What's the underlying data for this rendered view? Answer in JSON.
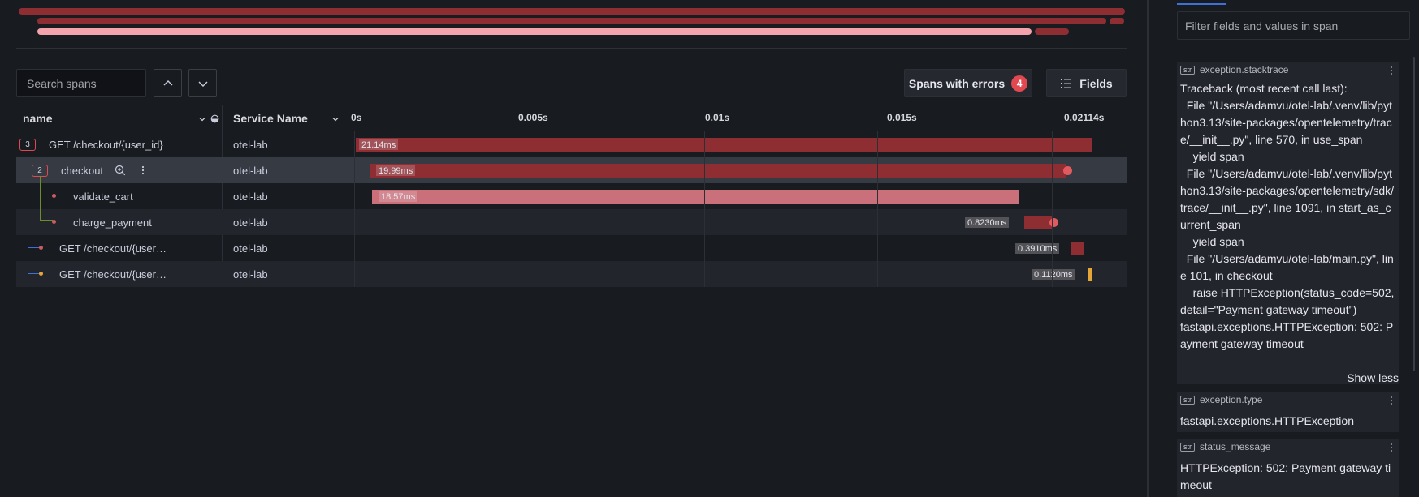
{
  "colors": {
    "error_bar": "#8e2e33",
    "error_bar_light": "#c9707a",
    "warning": "#e5a638",
    "accent": "#3d71d9",
    "error": "#e0494f"
  },
  "toolbar": {
    "search_placeholder": "Search spans",
    "prev_icon": "chevron-up-icon",
    "next_icon": "chevron-down-icon",
    "errors_label": "Spans with errors",
    "errors_count": "4",
    "fields_label": "Fields",
    "fields_icon": "columns-icon"
  },
  "table": {
    "columns": {
      "name": "name",
      "service": "Service Name"
    },
    "ticks": [
      "0s",
      "0.005s",
      "0.01s",
      "0.015s",
      "0.02114s"
    ],
    "rows": [
      {
        "name": "GET /checkout/{user_id}",
        "badge": "3",
        "service": "otel-lab",
        "duration": "21.14ms"
      },
      {
        "name": "checkout",
        "badge": "2",
        "service": "otel-lab",
        "duration": "19.99ms"
      },
      {
        "name": "validate_cart",
        "service": "otel-lab",
        "duration": "18.57ms"
      },
      {
        "name": "charge_payment",
        "service": "otel-lab",
        "duration": "0.8230ms"
      },
      {
        "name": "GET /checkout/{user…",
        "service": "otel-lab",
        "duration": "0.3910ms"
      },
      {
        "name": "GET /checkout/{user…",
        "service": "otel-lab",
        "duration": "0.1120ms"
      }
    ]
  },
  "panel": {
    "search_placeholder": "Filter fields and values in span",
    "fields": [
      {
        "type": "str",
        "key": "exception.stacktrace",
        "value": "Traceback (most recent call last):\n  File \"/Users/adamvu/otel-lab/.venv/lib/python3.13/site-packages/opentelemetry/trace/__init__.py\", line 570, in use_span\n    yield span\n  File \"/Users/adamvu/otel-lab/.venv/lib/python3.13/site-packages/opentelemetry/sdk/trace/__init__.py\", line 1091, in start_as_current_span\n    yield span\n  File \"/Users/adamvu/otel-lab/main.py\", line 101, in checkout\n    raise HTTPException(status_code=502, detail=\"Payment gateway timeout\")\nfastapi.exceptions.HTTPException: 502: Payment gateway timeout",
        "toggle": "Show less"
      },
      {
        "type": "str",
        "key": "exception.type",
        "value": "fastapi.exceptions.HTTPException"
      },
      {
        "type": "str",
        "key": "status_message",
        "value": "HTTPException: 502: Payment gateway timeout"
      }
    ]
  }
}
